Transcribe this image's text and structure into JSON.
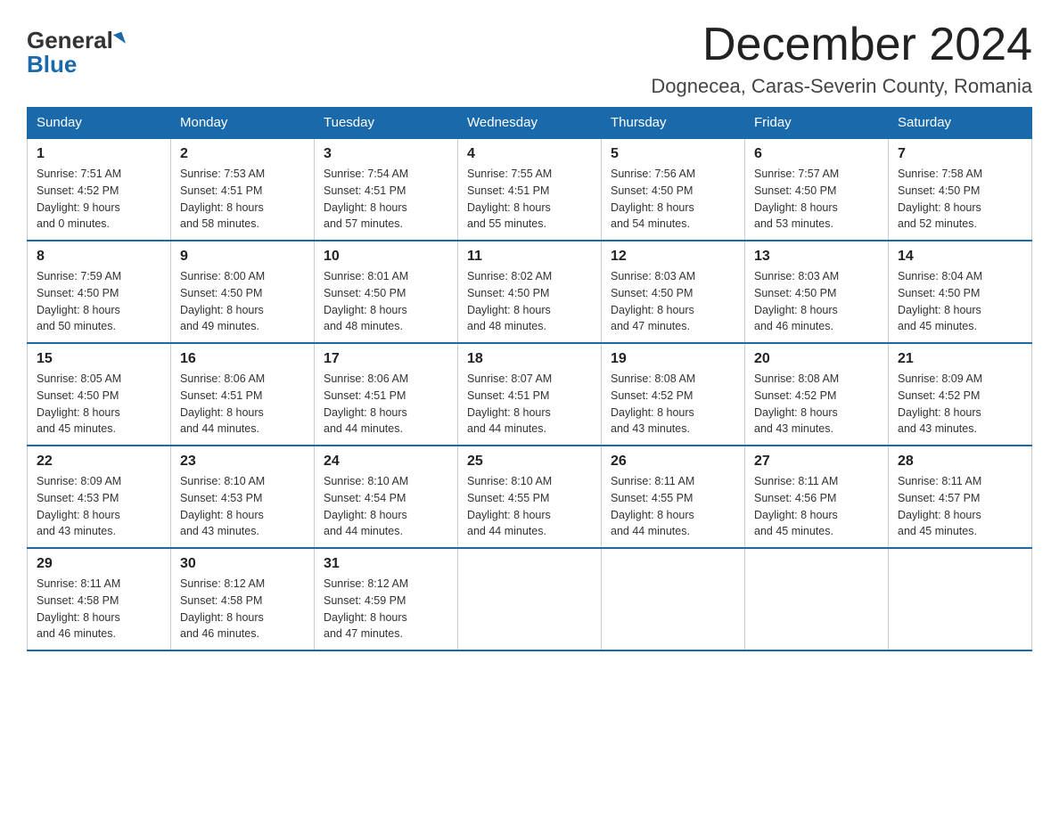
{
  "logo": {
    "general": "General",
    "blue": "Blue"
  },
  "header": {
    "month_year": "December 2024",
    "location": "Dognecea, Caras-Severin County, Romania"
  },
  "days_of_week": [
    "Sunday",
    "Monday",
    "Tuesday",
    "Wednesday",
    "Thursday",
    "Friday",
    "Saturday"
  ],
  "weeks": [
    [
      {
        "day": "1",
        "sunrise": "Sunrise: 7:51 AM",
        "sunset": "Sunset: 4:52 PM",
        "daylight": "Daylight: 9 hours",
        "minutes": "and 0 minutes."
      },
      {
        "day": "2",
        "sunrise": "Sunrise: 7:53 AM",
        "sunset": "Sunset: 4:51 PM",
        "daylight": "Daylight: 8 hours",
        "minutes": "and 58 minutes."
      },
      {
        "day": "3",
        "sunrise": "Sunrise: 7:54 AM",
        "sunset": "Sunset: 4:51 PM",
        "daylight": "Daylight: 8 hours",
        "minutes": "and 57 minutes."
      },
      {
        "day": "4",
        "sunrise": "Sunrise: 7:55 AM",
        "sunset": "Sunset: 4:51 PM",
        "daylight": "Daylight: 8 hours",
        "minutes": "and 55 minutes."
      },
      {
        "day": "5",
        "sunrise": "Sunrise: 7:56 AM",
        "sunset": "Sunset: 4:50 PM",
        "daylight": "Daylight: 8 hours",
        "minutes": "and 54 minutes."
      },
      {
        "day": "6",
        "sunrise": "Sunrise: 7:57 AM",
        "sunset": "Sunset: 4:50 PM",
        "daylight": "Daylight: 8 hours",
        "minutes": "and 53 minutes."
      },
      {
        "day": "7",
        "sunrise": "Sunrise: 7:58 AM",
        "sunset": "Sunset: 4:50 PM",
        "daylight": "Daylight: 8 hours",
        "minutes": "and 52 minutes."
      }
    ],
    [
      {
        "day": "8",
        "sunrise": "Sunrise: 7:59 AM",
        "sunset": "Sunset: 4:50 PM",
        "daylight": "Daylight: 8 hours",
        "minutes": "and 50 minutes."
      },
      {
        "day": "9",
        "sunrise": "Sunrise: 8:00 AM",
        "sunset": "Sunset: 4:50 PM",
        "daylight": "Daylight: 8 hours",
        "minutes": "and 49 minutes."
      },
      {
        "day": "10",
        "sunrise": "Sunrise: 8:01 AM",
        "sunset": "Sunset: 4:50 PM",
        "daylight": "Daylight: 8 hours",
        "minutes": "and 48 minutes."
      },
      {
        "day": "11",
        "sunrise": "Sunrise: 8:02 AM",
        "sunset": "Sunset: 4:50 PM",
        "daylight": "Daylight: 8 hours",
        "minutes": "and 48 minutes."
      },
      {
        "day": "12",
        "sunrise": "Sunrise: 8:03 AM",
        "sunset": "Sunset: 4:50 PM",
        "daylight": "Daylight: 8 hours",
        "minutes": "and 47 minutes."
      },
      {
        "day": "13",
        "sunrise": "Sunrise: 8:03 AM",
        "sunset": "Sunset: 4:50 PM",
        "daylight": "Daylight: 8 hours",
        "minutes": "and 46 minutes."
      },
      {
        "day": "14",
        "sunrise": "Sunrise: 8:04 AM",
        "sunset": "Sunset: 4:50 PM",
        "daylight": "Daylight: 8 hours",
        "minutes": "and 45 minutes."
      }
    ],
    [
      {
        "day": "15",
        "sunrise": "Sunrise: 8:05 AM",
        "sunset": "Sunset: 4:50 PM",
        "daylight": "Daylight: 8 hours",
        "minutes": "and 45 minutes."
      },
      {
        "day": "16",
        "sunrise": "Sunrise: 8:06 AM",
        "sunset": "Sunset: 4:51 PM",
        "daylight": "Daylight: 8 hours",
        "minutes": "and 44 minutes."
      },
      {
        "day": "17",
        "sunrise": "Sunrise: 8:06 AM",
        "sunset": "Sunset: 4:51 PM",
        "daylight": "Daylight: 8 hours",
        "minutes": "and 44 minutes."
      },
      {
        "day": "18",
        "sunrise": "Sunrise: 8:07 AM",
        "sunset": "Sunset: 4:51 PM",
        "daylight": "Daylight: 8 hours",
        "minutes": "and 44 minutes."
      },
      {
        "day": "19",
        "sunrise": "Sunrise: 8:08 AM",
        "sunset": "Sunset: 4:52 PM",
        "daylight": "Daylight: 8 hours",
        "minutes": "and 43 minutes."
      },
      {
        "day": "20",
        "sunrise": "Sunrise: 8:08 AM",
        "sunset": "Sunset: 4:52 PM",
        "daylight": "Daylight: 8 hours",
        "minutes": "and 43 minutes."
      },
      {
        "day": "21",
        "sunrise": "Sunrise: 8:09 AM",
        "sunset": "Sunset: 4:52 PM",
        "daylight": "Daylight: 8 hours",
        "minutes": "and 43 minutes."
      }
    ],
    [
      {
        "day": "22",
        "sunrise": "Sunrise: 8:09 AM",
        "sunset": "Sunset: 4:53 PM",
        "daylight": "Daylight: 8 hours",
        "minutes": "and 43 minutes."
      },
      {
        "day": "23",
        "sunrise": "Sunrise: 8:10 AM",
        "sunset": "Sunset: 4:53 PM",
        "daylight": "Daylight: 8 hours",
        "minutes": "and 43 minutes."
      },
      {
        "day": "24",
        "sunrise": "Sunrise: 8:10 AM",
        "sunset": "Sunset: 4:54 PM",
        "daylight": "Daylight: 8 hours",
        "minutes": "and 44 minutes."
      },
      {
        "day": "25",
        "sunrise": "Sunrise: 8:10 AM",
        "sunset": "Sunset: 4:55 PM",
        "daylight": "Daylight: 8 hours",
        "minutes": "and 44 minutes."
      },
      {
        "day": "26",
        "sunrise": "Sunrise: 8:11 AM",
        "sunset": "Sunset: 4:55 PM",
        "daylight": "Daylight: 8 hours",
        "minutes": "and 44 minutes."
      },
      {
        "day": "27",
        "sunrise": "Sunrise: 8:11 AM",
        "sunset": "Sunset: 4:56 PM",
        "daylight": "Daylight: 8 hours",
        "minutes": "and 45 minutes."
      },
      {
        "day": "28",
        "sunrise": "Sunrise: 8:11 AM",
        "sunset": "Sunset: 4:57 PM",
        "daylight": "Daylight: 8 hours",
        "minutes": "and 45 minutes."
      }
    ],
    [
      {
        "day": "29",
        "sunrise": "Sunrise: 8:11 AM",
        "sunset": "Sunset: 4:58 PM",
        "daylight": "Daylight: 8 hours",
        "minutes": "and 46 minutes."
      },
      {
        "day": "30",
        "sunrise": "Sunrise: 8:12 AM",
        "sunset": "Sunset: 4:58 PM",
        "daylight": "Daylight: 8 hours",
        "minutes": "and 46 minutes."
      },
      {
        "day": "31",
        "sunrise": "Sunrise: 8:12 AM",
        "sunset": "Sunset: 4:59 PM",
        "daylight": "Daylight: 8 hours",
        "minutes": "and 47 minutes."
      },
      null,
      null,
      null,
      null
    ]
  ]
}
